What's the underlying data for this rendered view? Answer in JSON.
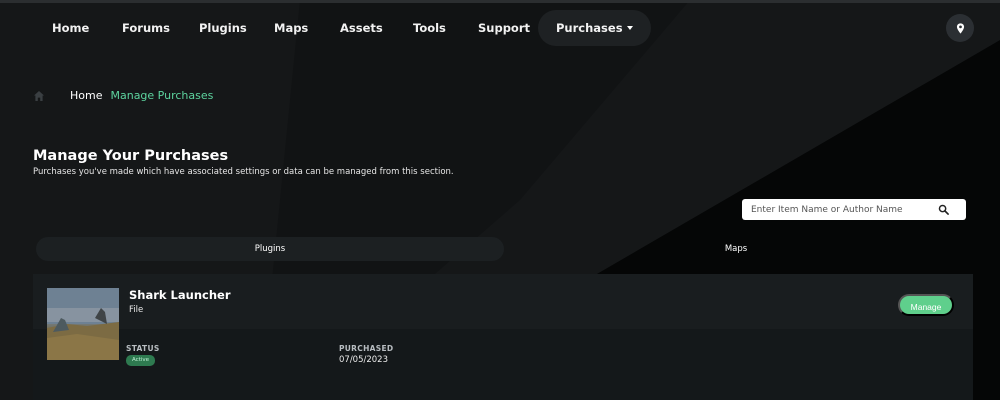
{
  "nav": {
    "items": [
      {
        "label": "Home"
      },
      {
        "label": "Forums"
      },
      {
        "label": "Plugins"
      },
      {
        "label": "Maps"
      },
      {
        "label": "Assets"
      },
      {
        "label": "Tools"
      },
      {
        "label": "Support"
      }
    ],
    "purchases_label": "Purchases",
    "location_icon": "map-pin-icon"
  },
  "breadcrumb": {
    "home_icon": "home-icon",
    "home": "Home",
    "current": "Manage Purchases"
  },
  "page": {
    "title": "Manage Your Purchases",
    "description": "Purchases you've made which have associated settings or data can be managed from this section."
  },
  "search": {
    "placeholder": "Enter Item Name or Author Name",
    "value": "",
    "icon": "search-icon"
  },
  "tabs": [
    {
      "label": "Plugins",
      "active": true
    },
    {
      "label": "Maps",
      "active": false
    }
  ],
  "purchase": {
    "title": "Shark Launcher",
    "type": "File",
    "manage_label": "Manage",
    "status_label": "STATUS",
    "status_value": "Active",
    "purchased_label": "PURCHASED",
    "purchased_value": "07/05/2023"
  },
  "colors": {
    "accent": "#5dd39e",
    "button": "#5fcf8c",
    "badge": "#2e7a50"
  }
}
